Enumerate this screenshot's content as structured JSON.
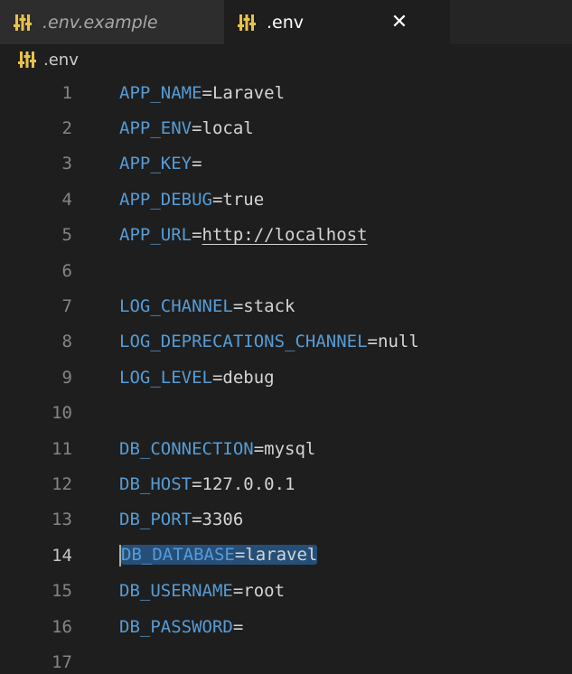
{
  "tabs": [
    {
      "label": ".env.example",
      "icon": "settings-sliders-icon",
      "active": false
    },
    {
      "label": ".env",
      "icon": "settings-sliders-icon",
      "active": true,
      "close": "✕"
    }
  ],
  "breadcrumb": {
    "label": ".env",
    "icon": "settings-sliders-icon"
  },
  "editor": {
    "current_line": 14,
    "lines": [
      {
        "num": "1",
        "key": "APP_NAME",
        "eq": "=",
        "val": "Laravel"
      },
      {
        "num": "2",
        "key": "APP_ENV",
        "eq": "=",
        "val": "local"
      },
      {
        "num": "3",
        "key": "APP_KEY",
        "eq": "=",
        "val": ""
      },
      {
        "num": "4",
        "key": "APP_DEBUG",
        "eq": "=",
        "val": "true"
      },
      {
        "num": "5",
        "key": "APP_URL",
        "eq": "=",
        "val": "http://localhost"
      },
      {
        "num": "6",
        "key": "",
        "eq": "",
        "val": ""
      },
      {
        "num": "7",
        "key": "LOG_CHANNEL",
        "eq": "=",
        "val": "stack"
      },
      {
        "num": "8",
        "key": "LOG_DEPRECATIONS_CHANNEL",
        "eq": "=",
        "val": "null"
      },
      {
        "num": "9",
        "key": "LOG_LEVEL",
        "eq": "=",
        "val": "debug"
      },
      {
        "num": "10",
        "key": "",
        "eq": "",
        "val": ""
      },
      {
        "num": "11",
        "key": "DB_CONNECTION",
        "eq": "=",
        "val": "mysql"
      },
      {
        "num": "12",
        "key": "DB_HOST",
        "eq": "=",
        "val": "127.0.0.1"
      },
      {
        "num": "13",
        "key": "DB_PORT",
        "eq": "=",
        "val": "3306"
      },
      {
        "num": "14",
        "key": "DB_DATABASE",
        "eq": "=",
        "val": "laravel"
      },
      {
        "num": "15",
        "key": "DB_USERNAME",
        "eq": "=",
        "val": "root"
      },
      {
        "num": "16",
        "key": "DB_PASSWORD",
        "eq": "=",
        "val": ""
      },
      {
        "num": "17",
        "key": "",
        "eq": "",
        "val": ""
      }
    ]
  },
  "colors": {
    "background": "#1e1e1e",
    "key": "#569cd6",
    "selection": "#264f78",
    "icon": "#e8c24a"
  }
}
